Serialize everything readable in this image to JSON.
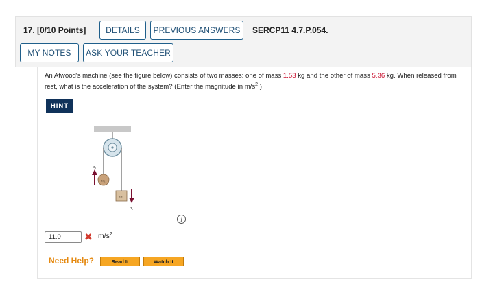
{
  "header": {
    "points_label": "17.  [0/10 Points]",
    "details_label": "DETAILS",
    "previous_answers_label": "PREVIOUS ANSWERS",
    "problem_id": "SERCP11 4.7.P.054.",
    "my_notes_label": "MY NOTES",
    "ask_teacher_label": "ASK YOUR TEACHER"
  },
  "question": {
    "text_1": "An Atwood's machine (see the figure below) consists of two masses: one of mass ",
    "mass1": "1.53",
    "text_2": " kg and the other of mass ",
    "mass2": "5.36",
    "text_3": " kg. When released from rest, what is the acceleration of the system? (Enter the magnitude in m/s",
    "exp": "2",
    "text_4": ".)"
  },
  "hint_label": "HINT",
  "figure": {
    "m1_label": "m₁",
    "m2_label": "m₂",
    "a1_label": "a₁",
    "a2_label": "a₂"
  },
  "info_icon": "i",
  "answer": {
    "value": "11.0",
    "status_icon": "✖",
    "unit": "m/s",
    "unit_exp": "2"
  },
  "help": {
    "label": "Need Help?",
    "read_label": "Read It",
    "watch_label": "Watch It"
  },
  "colors": {
    "accent": "#1f5f8b",
    "highlight": "#c8102e",
    "hint_bg": "#10325a",
    "help_orange": "#e58a12",
    "help_button": "#f6a623"
  }
}
